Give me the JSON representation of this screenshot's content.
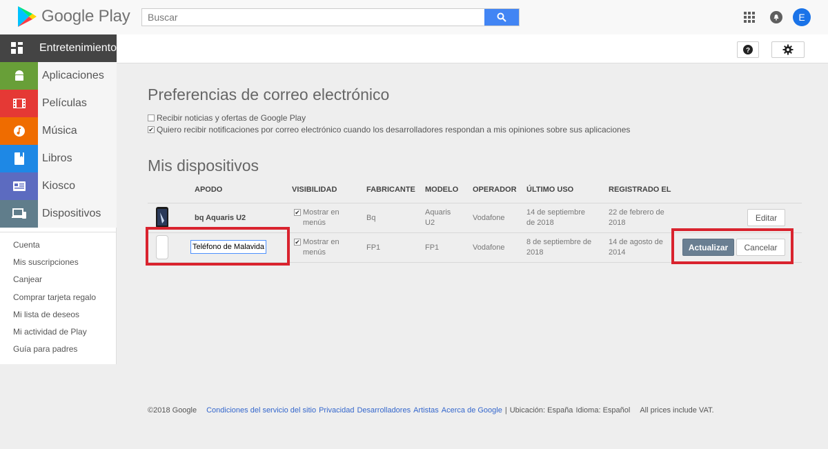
{
  "header": {
    "logo_text": "Google Play",
    "search_placeholder": "Buscar",
    "avatar_letter": "E"
  },
  "sidebar": {
    "items": [
      {
        "label": "Entretenimiento",
        "icon": "grid-icon",
        "color": "#444444"
      },
      {
        "label": "Aplicaciones",
        "icon": "android-icon",
        "color": "#689f38"
      },
      {
        "label": "Películas",
        "icon": "film-icon",
        "color": "#e53935"
      },
      {
        "label": "Música",
        "icon": "music-icon",
        "color": "#ef6c00"
      },
      {
        "label": "Libros",
        "icon": "book-icon",
        "color": "#1e88e5"
      },
      {
        "label": "Kiosco",
        "icon": "newsstand-icon",
        "color": "#5c6bc0"
      },
      {
        "label": "Dispositivos",
        "icon": "devices-icon",
        "color": "#607d8b"
      }
    ],
    "links": [
      "Cuenta",
      "Mis suscripciones",
      "Canjear",
      "Comprar tarjeta regalo",
      "Mi lista de deseos",
      "Mi actividad de Play",
      "Guía para padres"
    ]
  },
  "email_prefs": {
    "title": "Preferencias de correo electrónico",
    "options": [
      {
        "label": "Recibir noticias y ofertas de Google Play",
        "checked": false
      },
      {
        "label": "Quiero recibir notificaciones por correo electrónico cuando los desarrolladores respondan a mis opiniones sobre sus aplicaciones",
        "checked": true
      }
    ]
  },
  "devices": {
    "title": "Mis dispositivos",
    "columns": [
      "APODO",
      "VISIBILIDAD",
      "FABRICANTE",
      "MODELO",
      "OPERADOR",
      "ÚLTIMO USO",
      "REGISTRADO EL"
    ],
    "rows": [
      {
        "nickname": "bq Aquaris U2",
        "visibility": "Mostrar en menús",
        "visibility_checked": true,
        "manufacturer": "Bq",
        "model": "Aquaris U2",
        "operator": "Vodafone",
        "last_used": "14 de septiembre de 2018",
        "registered": "22 de febrero de 2018",
        "action": "Editar"
      },
      {
        "nickname": "Teléfono de Malavida",
        "visibility": "Mostrar en menús",
        "visibility_checked": true,
        "manufacturer": "FP1",
        "model": "FP1",
        "operator": "Vodafone",
        "last_used": "8 de septiembre de 2018",
        "registered": "14 de agosto de 2014",
        "update_label": "Actualizar",
        "cancel_label": "Cancelar"
      }
    ]
  },
  "footer": {
    "copyright": "©2018 Google",
    "links": [
      "Condiciones del servicio del sitio",
      "Privacidad",
      "Desarrolladores",
      "Artistas",
      "Acerca de Google"
    ],
    "separator": "|",
    "location": "Ubicación: España",
    "language": "Idioma: Español",
    "vat": "All prices include VAT."
  }
}
